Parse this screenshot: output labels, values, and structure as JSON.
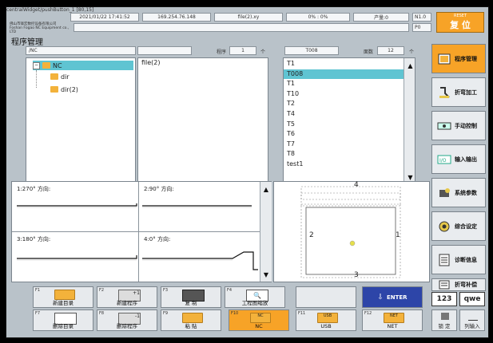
{
  "titlebar": {
    "text": "centralWidget/pushButton_1 [80,15]"
  },
  "status": {
    "datetime": "2021/01/22 17:41:52",
    "ip": "169.254.76.148",
    "file": "file(2).xy",
    "progress": "0% : 0%",
    "yield": "产量:0",
    "n": "N1.0",
    "p": "P0"
  },
  "company": {
    "line1": "佛山市锋宏数控设备有限公司",
    "line2": "Foshan Fogao NC Equipment co., LTD"
  },
  "reset_button": {
    "label": "复 位",
    "small": "RESET"
  },
  "page_title": "程序管理",
  "path": {
    "value": "/NC"
  },
  "program": {
    "label": "程序",
    "value": "1",
    "unit": "个"
  },
  "tool": {
    "value": "T008"
  },
  "face": {
    "label": "面数",
    "value": "12",
    "unit": "个"
  },
  "tree": {
    "root": "NC",
    "children": [
      "dir",
      "dir(2)"
    ]
  },
  "files": [
    "file(2)"
  ],
  "tools": [
    "T1",
    "T008",
    "T1",
    "T10",
    "T2",
    "T4",
    "T5",
    "T6",
    "T7",
    "T8",
    "test1"
  ],
  "waves": {
    "w1": "1:270° 方向:",
    "w2": "2:90° 方向:",
    "w3": "3:180° 方向:",
    "w4": "4:0° 方向:"
  },
  "preview": {
    "top": "4",
    "left": "2",
    "right": "1",
    "bottom": "3"
  },
  "sidebar": [
    {
      "label": "程序管理",
      "icon": "program-icon"
    },
    {
      "label": "折弯加工",
      "icon": "bend-icon"
    },
    {
      "label": "手动控制",
      "icon": "manual-icon"
    },
    {
      "label": "输入输出",
      "icon": "io-icon"
    },
    {
      "label": "系统参数",
      "icon": "system-icon"
    },
    {
      "label": "综合设定",
      "icon": "settings-icon"
    },
    {
      "label": "诊断信息",
      "icon": "diagnosis-icon"
    },
    {
      "label": "折弯补偿",
      "icon": "compensation-icon"
    }
  ],
  "fkeys": [
    {
      "key": "F1",
      "label": "新建目录"
    },
    {
      "key": "F2",
      "label": "新建程序",
      "tag": "+1"
    },
    {
      "key": "F3",
      "label": "复 制"
    },
    {
      "key": "F4",
      "label": "工程图缩放"
    },
    {
      "key": "F7",
      "label": "删除目录"
    },
    {
      "key": "F8",
      "label": "删除程序",
      "tag": "-1"
    },
    {
      "key": "F9",
      "label": "粘 贴"
    },
    {
      "key": "F10",
      "label": "NC",
      "tag": "NC"
    },
    {
      "key": "F11",
      "label": "USB",
      "tag": "USB"
    },
    {
      "key": "F12",
      "label": "NET",
      "tag": "NET"
    }
  ],
  "enter_button": {
    "label": "ENTER"
  },
  "kb": {
    "num": "123",
    "alpha": "qwe",
    "lock": "锁 定",
    "list": "列输入"
  },
  "colors": {
    "accent_orange": "#f7a327",
    "selection_cyan": "#5fc4d2",
    "enter_blue": "#2d45a8"
  }
}
